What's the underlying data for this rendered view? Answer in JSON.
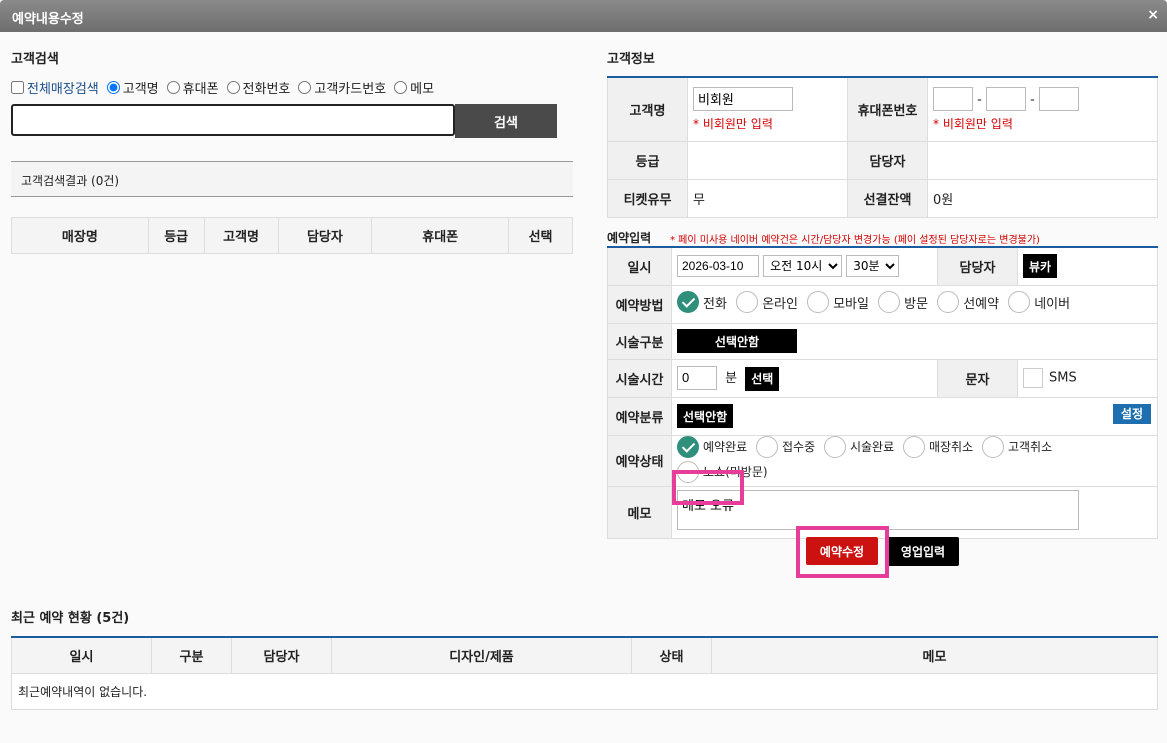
{
  "window": {
    "title": "예약내용수정",
    "close_icon": "×"
  },
  "customer_search": {
    "title": "고객검색",
    "all_store_label": "전체매장검색",
    "options": [
      "고객명",
      "휴대폰",
      "전화번호",
      "고객카드번호",
      "메모"
    ],
    "selected": "고객명",
    "input_value": "",
    "search_button": "검색",
    "result_text": "고객검색결과 (0건)",
    "columns": [
      "매장명",
      "등급",
      "고객명",
      "담당자",
      "휴대폰",
      "선택"
    ]
  },
  "customer_info": {
    "title": "고객정보",
    "name_label": "고객명",
    "name_value": "비회원",
    "name_note": "* 비회원만 입력",
    "phone_label": "휴대폰번호",
    "phone_parts": [
      "",
      "",
      ""
    ],
    "phone_sep": "-",
    "phone_note": "* 비회원만 입력",
    "grade_label": "등급",
    "grade_value": "",
    "staff_label": "담당자",
    "staff_value": "",
    "ticket_label": "티켓유무",
    "ticket_value": "무",
    "prepaid_label": "선결잔액",
    "prepaid_value": "0원"
  },
  "reservation": {
    "title": "예약입력",
    "note": "* 페이 미사용 네이버 예약건은 시간/담당자 변경가능 (페이 설정된 담당자로는 변경불가)",
    "datetime_label": "일시",
    "date_value": "2026-03-10",
    "hour_value": "오전 10시",
    "minute_value": "30분",
    "staff_label": "담당자",
    "staff_button": "뷰카",
    "method_label": "예약방법",
    "methods": [
      "전화",
      "온라인",
      "모바일",
      "방문",
      "선예약",
      "네이버"
    ],
    "method_selected": "전화",
    "service_label": "시술구분",
    "service_button": "선택안함",
    "duration_label": "시술시간",
    "duration_value": "0",
    "duration_unit": "분",
    "duration_button": "선택",
    "sms_label": "문자",
    "sms_text": "SMS",
    "category_label": "예약분류",
    "category_button": "선택안함",
    "setting_button": "설정",
    "status_label": "예약상태",
    "statuses": [
      "예약완료",
      "접수중",
      "시술완료",
      "매장취소",
      "고객취소",
      "노쇼(미방문)"
    ],
    "status_selected": "예약완료",
    "memo_label": "메모",
    "memo_value": "메모 오류"
  },
  "actions": {
    "edit_button": "예약수정",
    "sales_button": "영업입력"
  },
  "recent": {
    "title": "최근 예약 현황 (5건)",
    "columns": [
      "일시",
      "구분",
      "담당자",
      "디자인/제품",
      "상태",
      "메모"
    ],
    "empty_text": "최근예약내역이 없습니다."
  },
  "colors": {
    "accent_blue": "#1a5c9e",
    "red": "#cc1111",
    "highlight": "#e83c9a",
    "check_green": "#2f8f7a"
  }
}
